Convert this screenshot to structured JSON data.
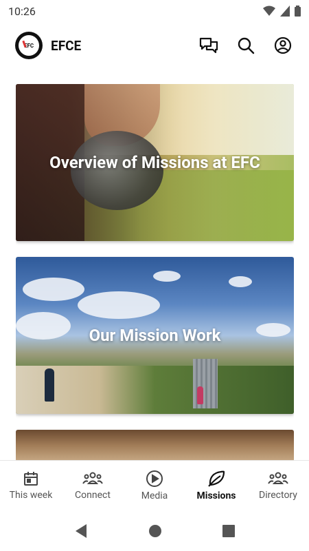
{
  "status_bar": {
    "time": "10:26"
  },
  "app_bar": {
    "title": "EFCE",
    "logo_text": "EFC"
  },
  "cards": [
    {
      "title": "Overview of Missions at EFC"
    },
    {
      "title": "Our Mission Work"
    },
    {
      "title": ""
    }
  ],
  "bottom_nav": {
    "items": [
      {
        "label": "This week",
        "icon": "calendar-icon"
      },
      {
        "label": "Connect",
        "icon": "people-icon"
      },
      {
        "label": "Media",
        "icon": "play-icon"
      },
      {
        "label": "Missions",
        "icon": "leaf-icon",
        "active": true
      },
      {
        "label": "Directory",
        "icon": "group-icon"
      }
    ]
  },
  "colors": {
    "accent": "#111111",
    "nav_inactive": "#555555"
  }
}
